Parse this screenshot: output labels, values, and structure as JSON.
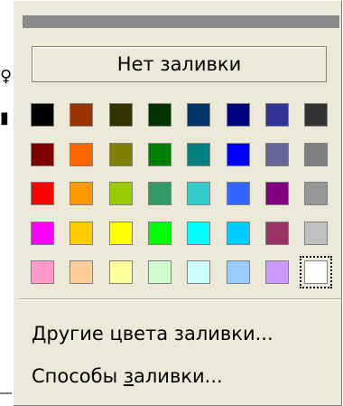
{
  "popup": {
    "no_fill_label": "Нет заливки",
    "more_colors_label": "Другие цвета заливки...",
    "fill_effects_prefix": "Способы ",
    "fill_effects_hotkey": "з",
    "fill_effects_suffix": "аливки..."
  },
  "palette": {
    "rows": [
      [
        "#000000",
        "#993300",
        "#333300",
        "#003300",
        "#003366",
        "#000080",
        "#333399",
        "#333333"
      ],
      [
        "#800000",
        "#FF6600",
        "#808000",
        "#008000",
        "#008080",
        "#0000FF",
        "#666699",
        "#808080"
      ],
      [
        "#FF0000",
        "#FF9900",
        "#99CC00",
        "#339966",
        "#33CCCC",
        "#3366FF",
        "#800080",
        "#969696"
      ],
      [
        "#FF00FF",
        "#FFCC00",
        "#FFFF00",
        "#00FF00",
        "#00FFFF",
        "#00CCFF",
        "#993366",
        "#C0C0C0"
      ],
      [
        "#FF99CC",
        "#FFCC99",
        "#FFFF99",
        "#CCFFCC",
        "#CCFFFF",
        "#99CCFF",
        "#CC99FF",
        "#FFFFFF"
      ]
    ],
    "selected": {
      "row": 4,
      "col": 7
    }
  }
}
